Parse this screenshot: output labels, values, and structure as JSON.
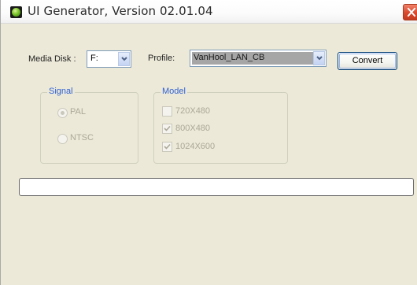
{
  "window": {
    "title": "UI Generator, Version 02.01.04",
    "icon": "app-globe-icon",
    "close_icon": "close-icon"
  },
  "media_disk": {
    "label": "Media Disk :",
    "value": "F:"
  },
  "profile": {
    "label": "Profile:",
    "value": "VanHool_LAN_CB"
  },
  "convert_button": {
    "label": "Convert"
  },
  "signal_group": {
    "legend": "Signal",
    "options": [
      {
        "label": "PAL",
        "checked": true,
        "enabled": false
      },
      {
        "label": "NTSC",
        "checked": false,
        "enabled": false
      }
    ]
  },
  "model_group": {
    "legend": "Model",
    "options": [
      {
        "label": "720X480",
        "checked": false,
        "enabled": false
      },
      {
        "label": "800X480",
        "checked": true,
        "enabled": false
      },
      {
        "label": "1024X600",
        "checked": true,
        "enabled": false
      }
    ]
  },
  "progress": {
    "value": 0
  },
  "colors": {
    "window_bg": "#ece9d8",
    "group_legend": "#2e5fd4",
    "disabled_text": "#aca899",
    "close_red": "#d9482c"
  }
}
